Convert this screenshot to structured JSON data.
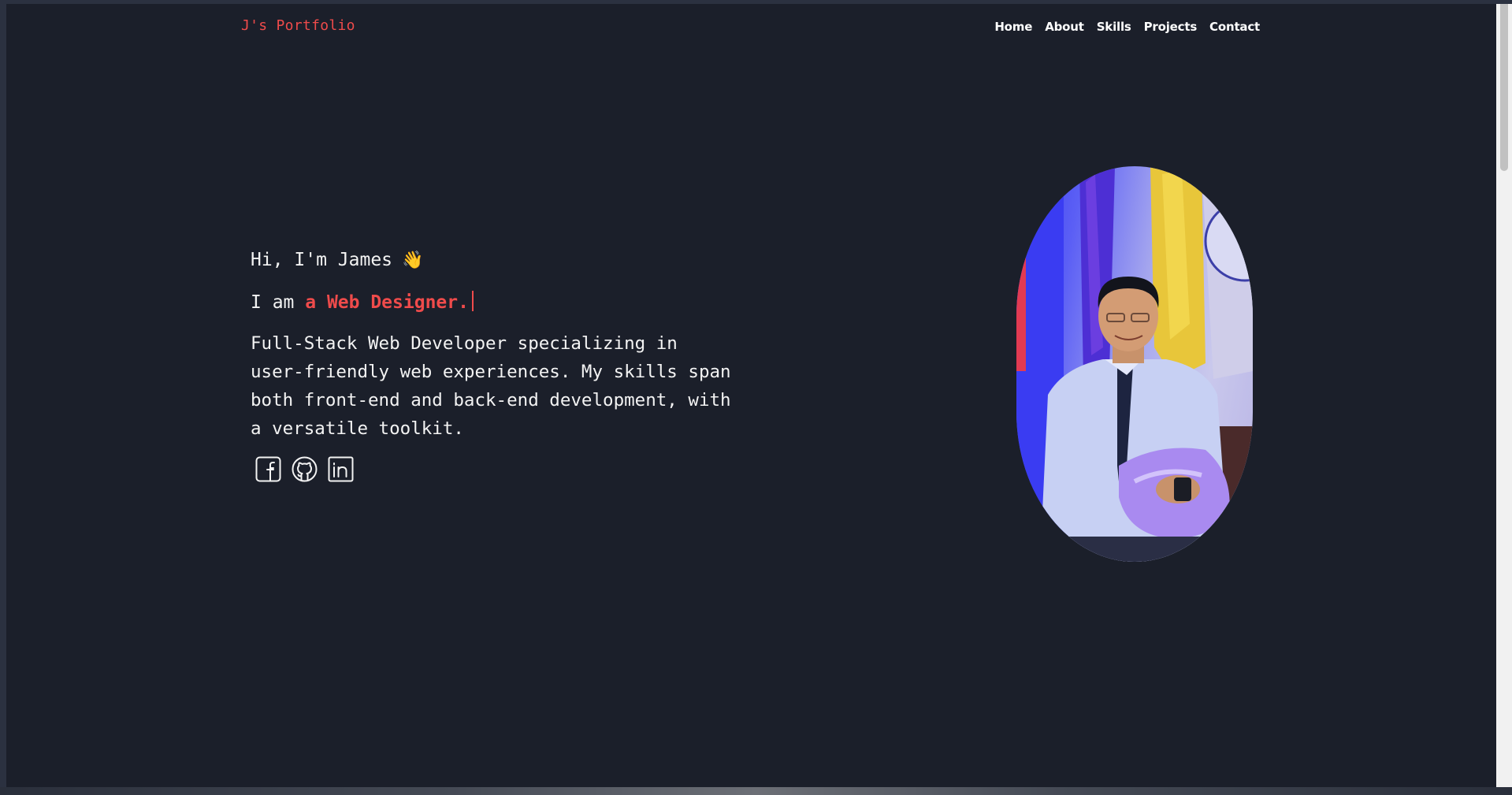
{
  "header": {
    "logo": "J's Portfolio",
    "nav": [
      "Home",
      "About",
      "Skills",
      "Projects",
      "Contact"
    ]
  },
  "hero": {
    "greeting": "Hi, I'm James",
    "greeting_emoji": "👋",
    "role_prefix": "I am ",
    "role_text": "a Web Designer.",
    "bio": "Full-Stack Web Developer specializing in user-friendly web experiences. My skills span both front-end and back-end development, with a versatile toolkit.",
    "socials": [
      {
        "icon": "facebook-icon"
      },
      {
        "icon": "github-icon"
      },
      {
        "icon": "linkedin-icon"
      }
    ],
    "portrait_alt": "portrait"
  },
  "colors": {
    "background": "#1b1f2a",
    "accent": "#ef4b4b",
    "text": "#f3f3f3"
  }
}
